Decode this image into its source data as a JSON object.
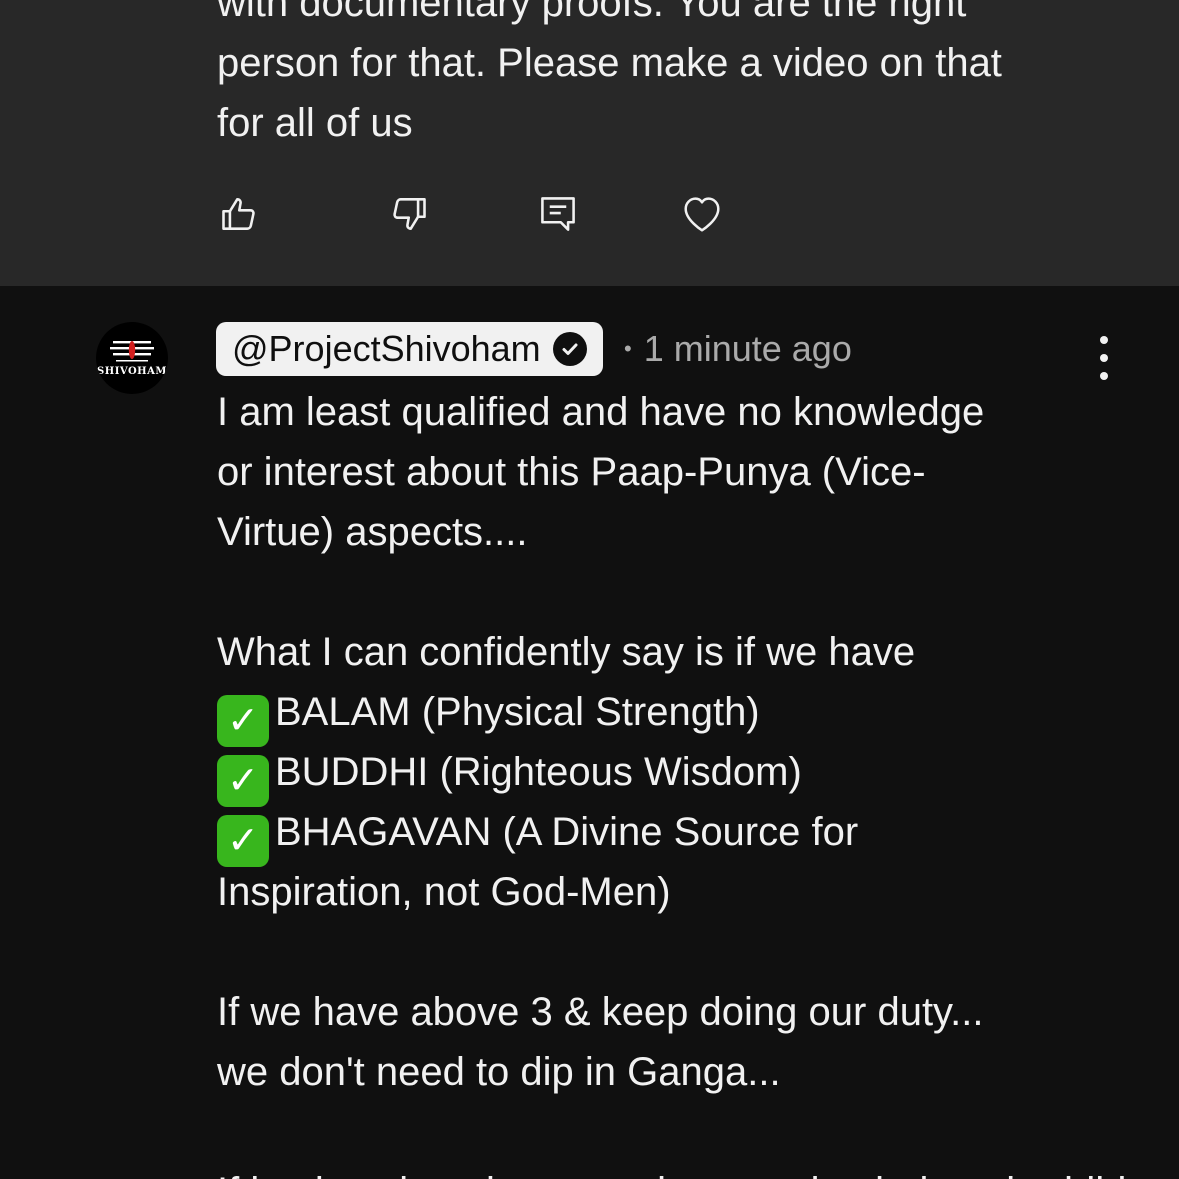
{
  "previous_comment": {
    "text_lines": [
      "with documentary proofs. You are the right",
      "person for that. Please make a video on that",
      "for all of us"
    ],
    "actions": {
      "like": "thumbs-up-icon",
      "dislike": "thumbs-down-icon",
      "reply": "reply-icon",
      "heart": "heart-icon"
    }
  },
  "reply": {
    "avatar_text": "SHIVOHAM",
    "author": "@ProjectShivoham",
    "separator": "•",
    "timestamp": "1 minute ago",
    "lines": [
      "I am least qualified and have no knowledge",
      "or interest about this Paap-Punya (Vice-",
      "Virtue) aspects....",
      "",
      "What I can confidently say is if we have",
      "BALAM (Physical Strength)",
      "BUDDHI (Righteous Wisdom)",
      "BHAGAVAN (A Divine Source for",
      "Inspiration, not God-Men)",
      "",
      "If we have above 3 & keep doing our duty...",
      "we don't need to dip in Ganga...",
      "",
      "If it takes time, let us work on getting balam, buddhi"
    ],
    "check_glyph": "✓"
  },
  "colors": {
    "panel_bg": "#282828",
    "page_bg": "#101010",
    "text": "#f1f1f1",
    "muted": "#aaaaaa",
    "check_green": "#38b61d"
  }
}
